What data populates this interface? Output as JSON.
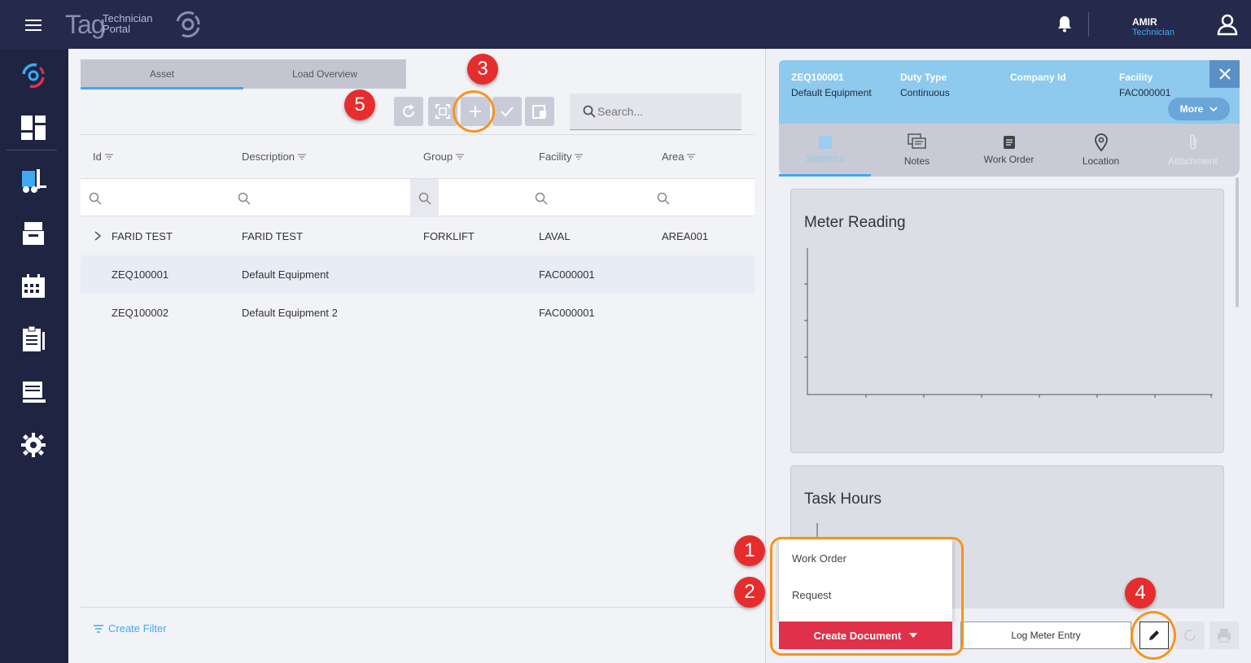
{
  "topbar": {
    "logo_main": "Tag",
    "logo_sub_line1": "Technician",
    "logo_sub_line2": "Portal",
    "user_name": "AMIR",
    "user_role": "Technician"
  },
  "tabs": [
    {
      "label": "Asset",
      "active": true
    },
    {
      "label": "Load Overview",
      "active": false
    }
  ],
  "search": {
    "placeholder": "Search..."
  },
  "table": {
    "columns": [
      "Id",
      "Description",
      "Group",
      "Facility",
      "Area"
    ],
    "rows": [
      {
        "id": "FARID TEST",
        "description": "FARID TEST",
        "group": "FORKLIFT",
        "facility": "LAVAL",
        "area": "AREA001"
      },
      {
        "id": "ZEQ100001",
        "description": "Default Equipment",
        "group": "",
        "facility": "FAC000001",
        "area": ""
      },
      {
        "id": "ZEQ100002",
        "description": "Default Equipment 2",
        "group": "",
        "facility": "FAC000001",
        "area": ""
      }
    ]
  },
  "footer": {
    "create_filter": "Create Filter"
  },
  "detail": {
    "fields": [
      {
        "label": "ZEQ100001",
        "value": "Default Equipment"
      },
      {
        "label": "Duty Type",
        "value": "Continuous"
      },
      {
        "label": "Company Id",
        "value": ""
      },
      {
        "label": "Facility",
        "value": "FAC000001"
      }
    ],
    "more_label": "More",
    "tabs": [
      {
        "label": "Statistics",
        "icon": "statistics-icon"
      },
      {
        "label": "Notes",
        "icon": "notes-icon"
      },
      {
        "label": "Work Order",
        "icon": "work-order-icon"
      },
      {
        "label": "Location",
        "icon": "location-icon"
      },
      {
        "label": "Attachment",
        "icon": "attachment-icon"
      }
    ],
    "cards": [
      {
        "title": "Meter Reading"
      },
      {
        "title": "Task Hours"
      }
    ]
  },
  "dropdown": {
    "items": [
      "Work Order",
      "Request"
    ]
  },
  "buttons": {
    "create_document": "Create Document",
    "log_meter_entry": "Log Meter Entry"
  },
  "annotations": [
    "1",
    "2",
    "3",
    "4",
    "5"
  ],
  "colors": {
    "topbar": "#252a4c",
    "sidebar": "#1f2443",
    "accent": "#3fa9f5",
    "detail_header": "#8ec9ee",
    "create_document": "#e0304a",
    "annotation_ring": "#f7941d",
    "annotation_badge": "#e52d2d"
  }
}
